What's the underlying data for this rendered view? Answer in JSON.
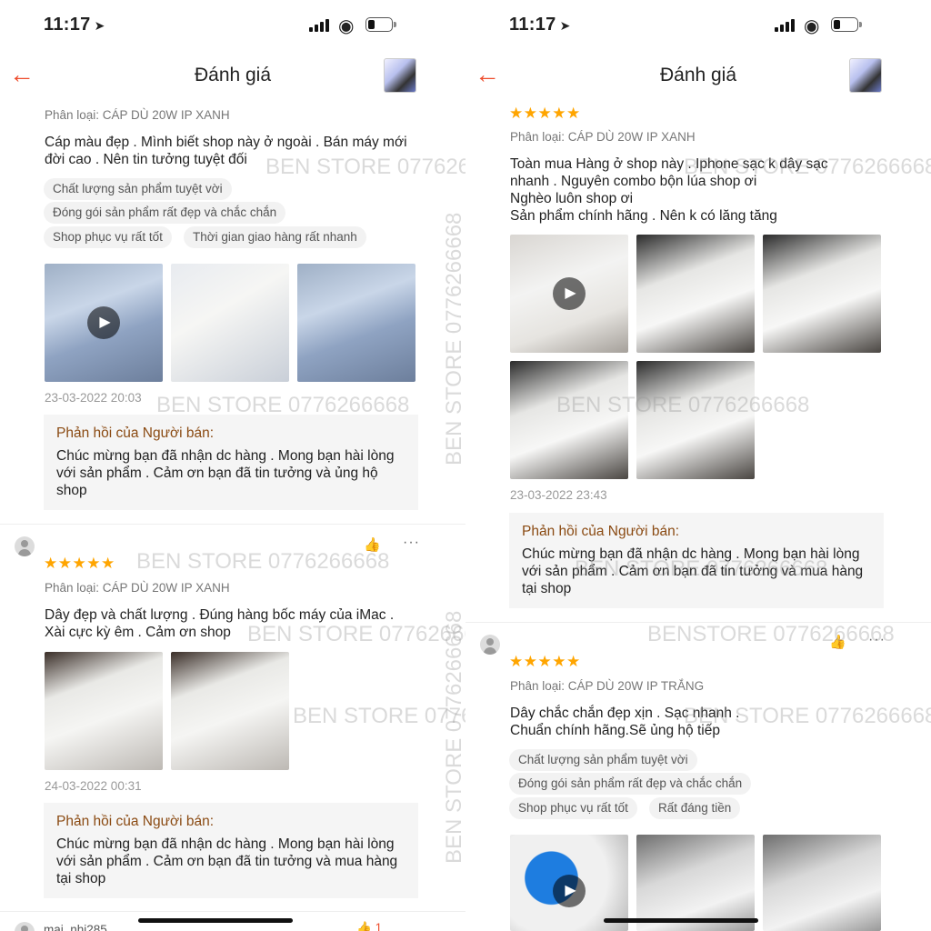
{
  "colors": {
    "accent": "#ee4d2d",
    "star": "#ffa500",
    "reply_label": "#8a4a12"
  },
  "status": {
    "time": "11:17",
    "location_icon": "location-arrow-icon",
    "signal_icon": "signal-icon",
    "wifi_icon": "wifi-icon",
    "battery_icon": "battery-icon",
    "battery_level": 0.2
  },
  "nav": {
    "back_icon": "back-arrow-icon",
    "title": "Đánh giá",
    "product_thumb": "product-thumbnail"
  },
  "watermark": "BEN STORE 0776266668",
  "watermark_alt": "BENSTORE 0776266668",
  "left": {
    "review1": {
      "variant": "Phân loại: CÁP DÙ 20W IP XANH",
      "text": "Cáp màu đẹp . Mình biết shop này ở ngoài . Bán máy mới\nđời cao . Nên tin tưởng tuyệt đối",
      "tags": [
        "Chất lượng sản phẩm tuyệt vời",
        "Đóng gói sản phẩm rất đẹp và chắc chắn",
        "Shop phục vụ rất tốt",
        "Thời gian giao hàng rất nhanh"
      ],
      "date": "23-03-2022 20:03",
      "reply_label": "Phản hồi của Người bán:",
      "reply": "Chúc mừng bạn đã nhận dc hàng . Mong bạn hài lòng\nvới sản phẩm . Cảm ơn bạn đã tin tưởng và ủng hộ\nshop"
    },
    "review2": {
      "rating": 5,
      "stars": "★★★★★",
      "variant": "Phân loại: CÁP DÙ 20W IP XANH",
      "text": "Dây đẹp và chất lượng . Đúng hàng bốc máy của iMac .\nXài cực kỳ êm . Cảm ơn shop",
      "date": "24-03-2022 00:31",
      "reply_label": "Phản hồi của Người bán:",
      "reply": "Chúc mừng bạn đã nhận dc hàng . Mong bạn hài lòng\nvới sản phẩm . Cảm ơn bạn đã tin tưởng và mua hàng\ntại shop"
    },
    "review3": {
      "username": "mai_nhi285",
      "likes": "1"
    }
  },
  "right": {
    "review1": {
      "rating": 5,
      "stars": "★★★★★",
      "variant": "Phân loại: CÁP DÙ 20W IP XANH",
      "text": "Toàn mua Hàng ở shop này . Iphone sạc k dây sạc\nnhanh . Nguyên combo bộn lúa shop ơi\nNghèo luôn shop ơi\nSản phẩm chính hãng . Nên k có lăng tăng",
      "date": "23-03-2022 23:43",
      "reply_label": "Phản hồi của Người bán:",
      "reply": "Chúc mừng bạn đã nhận dc hàng . Mong bạn hài lòng\nvới sản phẩm . Cảm ơn bạn đã tin tưởng và mua hàng\ntại shop"
    },
    "review2": {
      "rating": 5,
      "stars": "★★★★★",
      "variant": "Phân loại: CÁP DÙ 20W IP TRẮNG",
      "text": "Dây chắc chắn đẹp xịn . Sạc nhanh .\nChuẩn chính hãng.Sẽ ủng hộ tiếp",
      "tags": [
        "Chất lượng sản phẩm tuyệt vời",
        "Đóng gói sản phẩm rất đẹp và chắc chắn",
        "Shop phục vụ rất tốt",
        "Rất đáng tiền"
      ]
    }
  }
}
